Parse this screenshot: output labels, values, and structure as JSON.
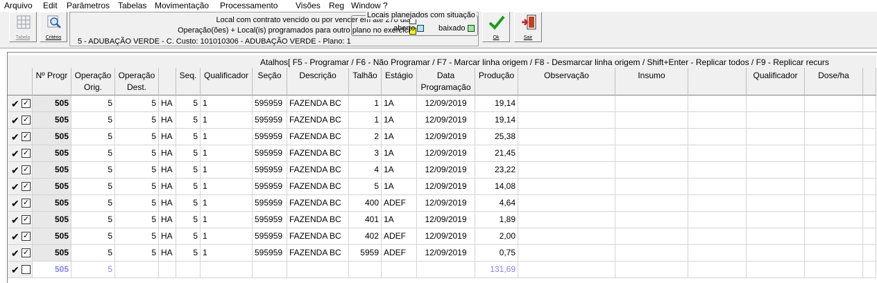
{
  "menu": [
    "Arquivo",
    "Edit",
    "Parâmetros",
    "Tabelas",
    "Movimentação",
    "Processamento",
    "Visões",
    "Reg",
    "Window",
    "?"
  ],
  "toolbar": {
    "tabela_label": "Tabela",
    "criterio_label": "Critério",
    "ok_label": "Ok",
    "sair_label": "Sair"
  },
  "info": {
    "line1": "Local com contrato vencido ou por vencer em até 270 dias",
    "line2": "Operação(ões) + Local(is) programados para outro plano no exercício",
    "line3": "5 - ADUBAÇÃO VERDE - C. Custo: 101010306 - ADUBAÇÃO VERDE - Plano: 1",
    "group_title": "Locais planejados com situação",
    "aberto": "aberto",
    "baixado": "baixado",
    "colors": {
      "line1": "#ffffff",
      "line2": "#ffff00",
      "aberto": "#a8e8f8",
      "baixado": "#90f090"
    }
  },
  "grid": {
    "shortcuts": "Atalhos[ F5 - Programar / F6 - Não Programar / F7 - Marcar linha origem / F8 - Desmarcar linha origem / Shift+Enter - Replicar todos / F9 - Replicar recurs",
    "headers": {
      "nprog": "Nº Progr",
      "op_orig": "Operação Orig.",
      "op_dest": "Operação Dest.",
      "seq": "Seq.",
      "qualificador": "Qualificador",
      "secao": "Seção",
      "descricao": "Descrição",
      "talhao": "Talhão",
      "estagio": "Estágio",
      "data_prog": "Data Programação",
      "producao": "Produção",
      "observacao": "Observação",
      "insumo": "Insumo",
      "qualificador2": "Qualificador",
      "dose": "Dose/ha"
    },
    "rows": [
      {
        "nprog": "505",
        "orig": "5",
        "dest": "5",
        "un": "HA",
        "seq": "5",
        "qual": "1",
        "secao": "595959",
        "desc": "FAZENDA BC",
        "talhao": "1",
        "estagio": "1A",
        "data": "12/09/2019",
        "prod": "19,14"
      },
      {
        "nprog": "505",
        "orig": "5",
        "dest": "5",
        "un": "HA",
        "seq": "5",
        "qual": "1",
        "secao": "595959",
        "desc": "FAZENDA BC",
        "talhao": "1",
        "estagio": "1A",
        "data": "12/09/2019",
        "prod": "19,14"
      },
      {
        "nprog": "505",
        "orig": "5",
        "dest": "5",
        "un": "HA",
        "seq": "5",
        "qual": "1",
        "secao": "595959",
        "desc": "FAZENDA BC",
        "talhao": "2",
        "estagio": "1A",
        "data": "12/09/2019",
        "prod": "25,38"
      },
      {
        "nprog": "505",
        "orig": "5",
        "dest": "5",
        "un": "HA",
        "seq": "5",
        "qual": "1",
        "secao": "595959",
        "desc": "FAZENDA BC",
        "talhao": "3",
        "estagio": "1A",
        "data": "12/09/2019",
        "prod": "21,45"
      },
      {
        "nprog": "505",
        "orig": "5",
        "dest": "5",
        "un": "HA",
        "seq": "5",
        "qual": "1",
        "secao": "595959",
        "desc": "FAZENDA BC",
        "talhao": "4",
        "estagio": "1A",
        "data": "12/09/2019",
        "prod": "23,22"
      },
      {
        "nprog": "505",
        "orig": "5",
        "dest": "5",
        "un": "HA",
        "seq": "5",
        "qual": "1",
        "secao": "595959",
        "desc": "FAZENDA BC",
        "talhao": "5",
        "estagio": "1A",
        "data": "12/09/2019",
        "prod": "14,08"
      },
      {
        "nprog": "505",
        "orig": "5",
        "dest": "5",
        "un": "HA",
        "seq": "5",
        "qual": "1",
        "secao": "595959",
        "desc": "FAZENDA BC",
        "talhao": "400",
        "estagio": "ADEF",
        "data": "12/09/2019",
        "prod": "4,64"
      },
      {
        "nprog": "505",
        "orig": "5",
        "dest": "5",
        "un": "HA",
        "seq": "5",
        "qual": "1",
        "secao": "595959",
        "desc": "FAZENDA BC",
        "talhao": "401",
        "estagio": "1A",
        "data": "12/09/2019",
        "prod": "1,89"
      },
      {
        "nprog": "505",
        "orig": "5",
        "dest": "5",
        "un": "HA",
        "seq": "5",
        "qual": "1",
        "secao": "595959",
        "desc": "FAZENDA BC",
        "talhao": "402",
        "estagio": "ADEF",
        "data": "12/09/2019",
        "prod": "2,00"
      },
      {
        "nprog": "505",
        "orig": "5",
        "dest": "5",
        "un": "HA",
        "seq": "5",
        "qual": "1",
        "secao": "595959",
        "desc": "FAZENDA BC",
        "talhao": "5959",
        "estagio": "ADEF",
        "data": "12/09/2019",
        "prod": "0,75"
      }
    ],
    "total": {
      "nprog": "505",
      "orig": "5",
      "prod": "131,69"
    }
  }
}
